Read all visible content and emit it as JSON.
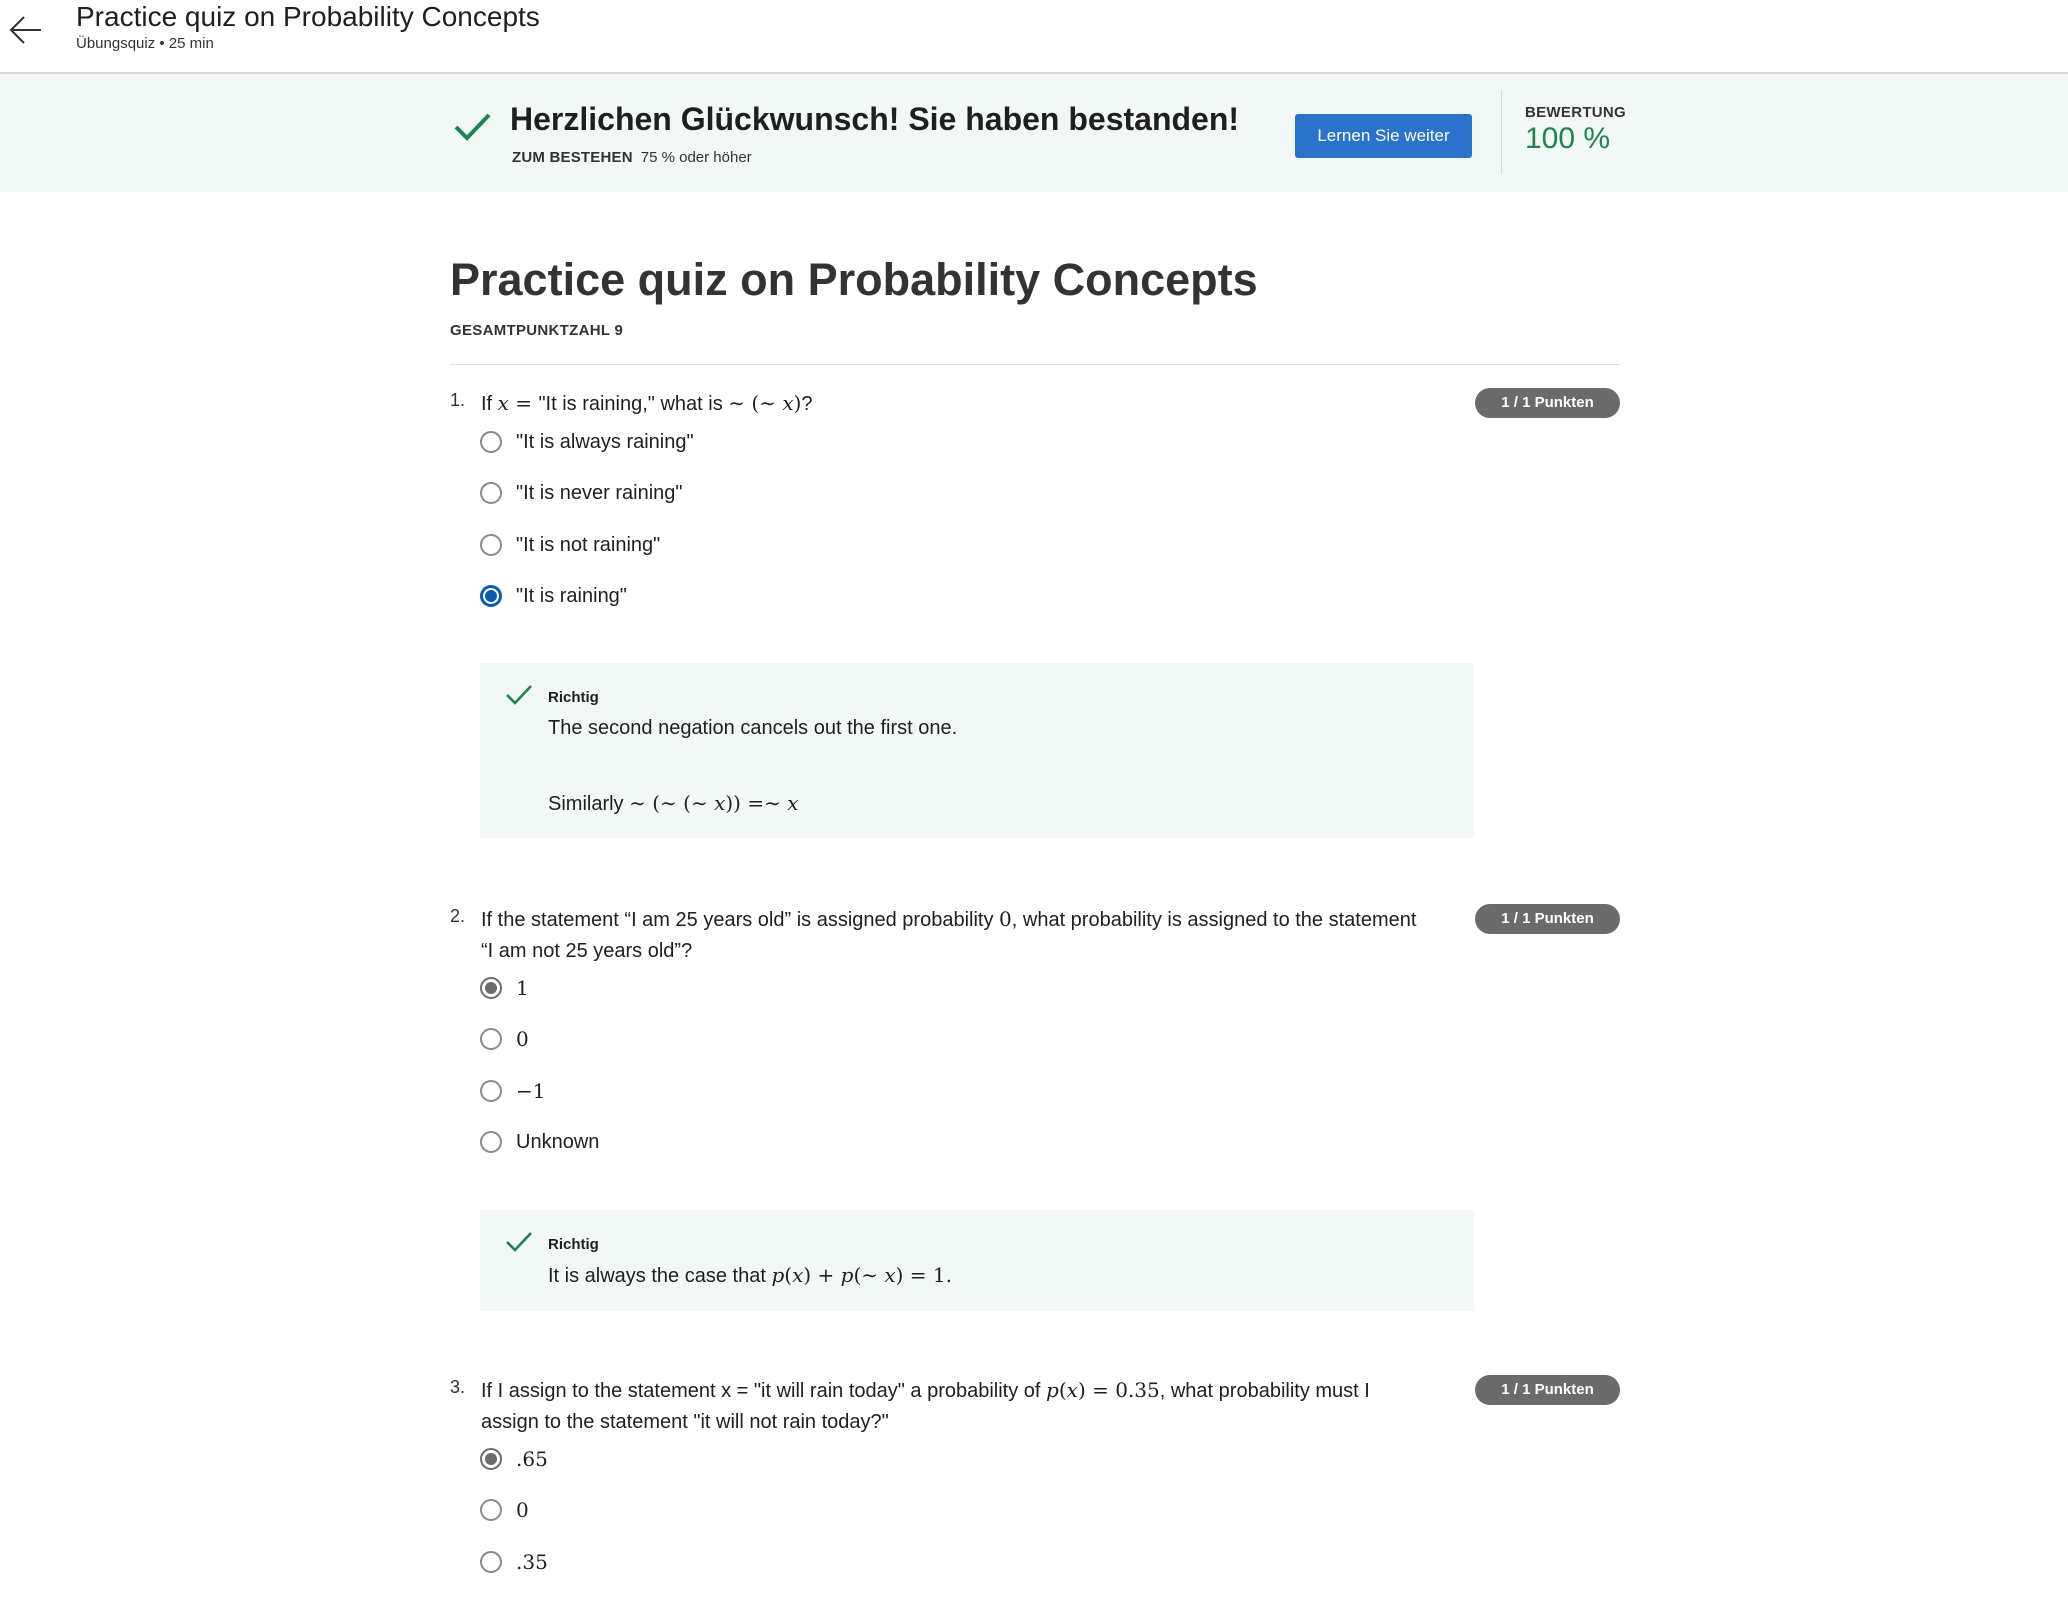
{
  "header": {
    "title": "Practice quiz on Probability Concepts",
    "subtitle": "Übungsquiz • 25 min",
    "back_icon": "arrow-left-icon"
  },
  "banner": {
    "message": "Herzlichen Glückwunsch! Sie haben bestanden!",
    "pass_label": "ZUM BESTEHEN",
    "pass_value": "75 % oder höher",
    "continue_label": "Lernen Sie weiter",
    "grade_label": "BEWERTUNG",
    "grade_value": "100 %",
    "accent": "#1f8354",
    "button_color": "#2a73cc"
  },
  "quiz": {
    "title": "Practice quiz on Probability Concepts",
    "total": "GESAMTPUNKTZAHL 9"
  },
  "questions": [
    {
      "number": "1.",
      "text_a": "If ",
      "var_x": "x",
      "eq": " = ",
      "text_b": "\"It is raining,\" what is ",
      "expr": "∼ (∼ ",
      "expr_close": ")",
      "text_c": "?",
      "points": "1 / 1 Punkten",
      "options": [
        "\"It is always raining\"",
        "\"It is never raining\"",
        "\"It is not raining\"",
        "\"It is raining\""
      ],
      "selected_index": 3,
      "feedback_label": "Richtig",
      "feedback_line1": "The second negation cancels out the first one.",
      "feedback_line2_prefix": "Similarly ",
      "feedback_line2_expr": "∼ (∼ (∼ ",
      "feedback_line2_close": ")) =∼ "
    },
    {
      "number": "2.",
      "text_a": "If the statement “I am 25 years old” is assigned probability ",
      "num_zero": "0",
      "text_b": ", what probability is assigned to the statement",
      "text_c": "“I am not 25 years old”?",
      "points": "1 / 1 Punkten",
      "options": [
        "1",
        "0",
        "−1",
        "Unknown"
      ],
      "selected_index": 0,
      "feedback_label": "Richtig",
      "feedback_prefix": "It is always the case that ",
      "feedback_expr_p": "p",
      "feedback_expr_open": "(",
      "feedback_expr_mid": ") + ",
      "feedback_expr_mid2": "(∼ ",
      "feedback_expr_end": ") = 1."
    },
    {
      "number": "3.",
      "text_a": "If I assign to the statement x = \"it will rain today\" a probability of ",
      "expr": ") = 0.35",
      "text_b": ", what probability must I",
      "text_c": "assign to the statement \"it will not rain today?\"",
      "points": "1 / 1 Punkten",
      "options": [
        ".65",
        "0",
        ".35"
      ],
      "selected_index": 0
    }
  ]
}
